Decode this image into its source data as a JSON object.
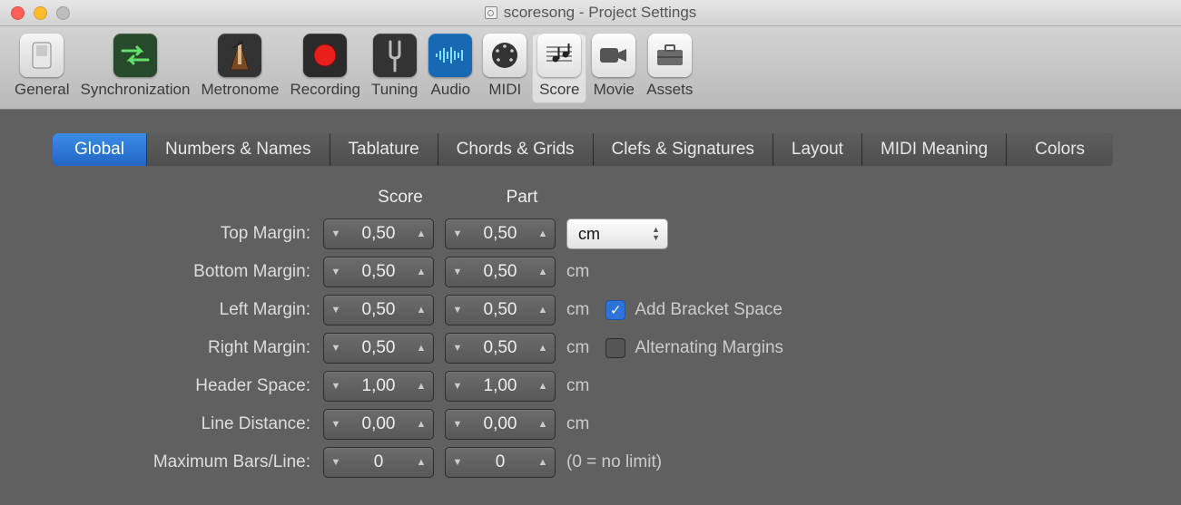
{
  "window": {
    "title": "scoresong - Project Settings"
  },
  "toolbar": {
    "items": [
      {
        "label": "General"
      },
      {
        "label": "Synchronization"
      },
      {
        "label": "Metronome"
      },
      {
        "label": "Recording"
      },
      {
        "label": "Tuning"
      },
      {
        "label": "Audio"
      },
      {
        "label": "MIDI"
      },
      {
        "label": "Score"
      },
      {
        "label": "Movie"
      },
      {
        "label": "Assets"
      }
    ]
  },
  "tabs": [
    {
      "label": "Global"
    },
    {
      "label": "Numbers & Names"
    },
    {
      "label": "Tablature"
    },
    {
      "label": "Chords & Grids"
    },
    {
      "label": "Clefs & Signatures"
    },
    {
      "label": "Layout"
    },
    {
      "label": "MIDI Meaning"
    },
    {
      "label": "Colors"
    }
  ],
  "form": {
    "col_score": "Score",
    "col_part": "Part",
    "unit_select": "cm",
    "rows": [
      {
        "label": "Top Margin:",
        "score": "0,50",
        "part": "0,50",
        "suffix": "select"
      },
      {
        "label": "Bottom Margin:",
        "score": "0,50",
        "part": "0,50",
        "suffix": "cm"
      },
      {
        "label": "Left Margin:",
        "score": "0,50",
        "part": "0,50",
        "suffix": "cm",
        "checkbox": {
          "checked": true,
          "label": "Add Bracket Space"
        }
      },
      {
        "label": "Right Margin:",
        "score": "0,50",
        "part": "0,50",
        "suffix": "cm",
        "checkbox": {
          "checked": false,
          "label": "Alternating Margins"
        }
      },
      {
        "label": "Header Space:",
        "score": "1,00",
        "part": "1,00",
        "suffix": "cm"
      },
      {
        "label": "Line Distance:",
        "score": "0,00",
        "part": "0,00",
        "suffix": "cm"
      },
      {
        "label": "Maximum Bars/Line:",
        "score": "0",
        "part": "0",
        "suffix": "(0 = no limit)"
      }
    ]
  }
}
